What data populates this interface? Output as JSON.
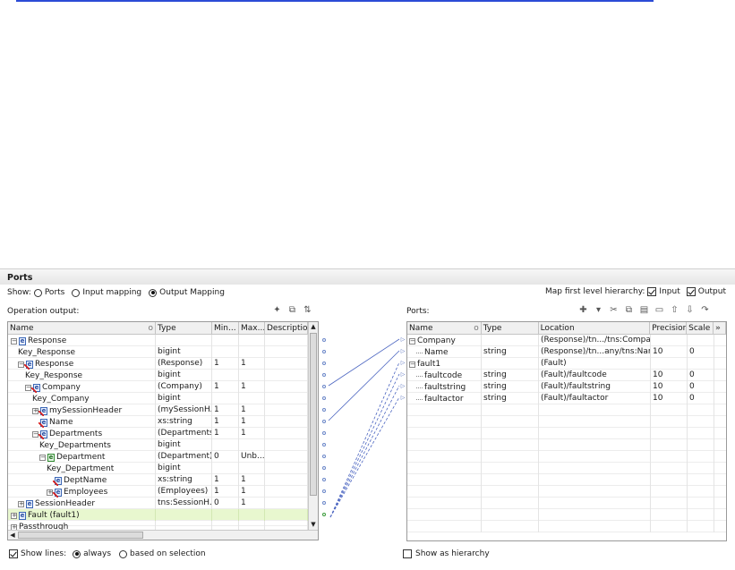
{
  "panel": {
    "title": "Ports"
  },
  "show": {
    "label": "Show:",
    "options": [
      {
        "label": "Ports",
        "selected": false
      },
      {
        "label": "Input mapping",
        "selected": false
      },
      {
        "label": "Output Mapping",
        "selected": true
      }
    ]
  },
  "hierarchy": {
    "label": "Map first level hierarchy:",
    "input_label": "Input",
    "input_checked": true,
    "output_label": "Output",
    "output_checked": true
  },
  "left": {
    "label": "Operation output:",
    "toolbar_icons": [
      "add-port-icon",
      "copy-icon",
      "sort-icon"
    ],
    "columns": [
      "Name",
      "Type",
      "Min...",
      "Max...",
      "Description"
    ],
    "rows": [
      {
        "name": "Response",
        "type": "",
        "min": "",
        "max": "",
        "level": 0,
        "exp": "−",
        "icon": "e"
      },
      {
        "name": "Key_Response",
        "type": "bigint",
        "min": "",
        "max": "",
        "level": 1,
        "exp": "",
        "icon": ""
      },
      {
        "name": "Response",
        "type": "(Response)",
        "min": "1",
        "max": "1",
        "level": 1,
        "exp": "−",
        "icon": "e-red"
      },
      {
        "name": "Key_Response",
        "type": "bigint",
        "min": "",
        "max": "",
        "level": 2,
        "exp": "",
        "icon": ""
      },
      {
        "name": "Company",
        "type": "(Company)",
        "min": "1",
        "max": "1",
        "level": 2,
        "exp": "−",
        "icon": "e-red"
      },
      {
        "name": "Key_Company",
        "type": "bigint",
        "min": "",
        "max": "",
        "level": 3,
        "exp": "",
        "icon": ""
      },
      {
        "name": "mySessionHeader",
        "type": "(mySessionH...",
        "min": "1",
        "max": "1",
        "level": 3,
        "exp": "+",
        "icon": "e-red"
      },
      {
        "name": "Name",
        "type": "xs:string",
        "min": "1",
        "max": "1",
        "level": 3,
        "exp": "",
        "icon": "e-red"
      },
      {
        "name": "Departments",
        "type": "(Departments)",
        "min": "1",
        "max": "1",
        "level": 3,
        "exp": "−",
        "icon": "e-red"
      },
      {
        "name": "Key_Departments",
        "type": "bigint",
        "min": "",
        "max": "",
        "level": 4,
        "exp": "",
        "icon": ""
      },
      {
        "name": "Department",
        "type": "(Department)",
        "min": "0",
        "max": "Unb...",
        "level": 4,
        "exp": "−",
        "icon": "e-grn"
      },
      {
        "name": "Key_Department",
        "type": "bigint",
        "min": "",
        "max": "",
        "level": 5,
        "exp": "",
        "icon": ""
      },
      {
        "name": "DeptName",
        "type": "xs:string",
        "min": "1",
        "max": "1",
        "level": 5,
        "exp": "",
        "icon": "e-red"
      },
      {
        "name": "Employees",
        "type": "(Employees)",
        "min": "1",
        "max": "1",
        "level": 5,
        "exp": "+",
        "icon": "e-red"
      },
      {
        "name": "SessionHeader",
        "type": "tns:SessionH...",
        "min": "0",
        "max": "1",
        "level": 1,
        "exp": "+",
        "icon": "e"
      },
      {
        "name": "Fault (fault1)",
        "type": "",
        "min": "",
        "max": "",
        "level": 0,
        "exp": "+",
        "icon": "e",
        "highlight": true
      },
      {
        "name": "Passthrough",
        "type": "",
        "min": "",
        "max": "",
        "level": 0,
        "exp": "+",
        "icon": "",
        "cut": true
      }
    ]
  },
  "right": {
    "label": "Ports:",
    "toolbar_icons": [
      "new-icon",
      "dropdown-icon",
      "cut-icon",
      "copy-icon",
      "paste-icon",
      "delete-icon",
      "move-up-icon",
      "move-down-icon",
      "more-icon"
    ],
    "columns": [
      "Name",
      "Type",
      "Location",
      "Precision",
      "Scale"
    ],
    "rows": [
      {
        "name": "Company",
        "type": "",
        "location": "(Response)/tn.../tns:Company",
        "precision": "",
        "scale": "",
        "level": 0,
        "exp": "−"
      },
      {
        "name": "Name",
        "type": "string",
        "location": "(Response)/tn...any/tns:Name",
        "precision": "10",
        "scale": "0",
        "level": 1,
        "exp": ""
      },
      {
        "name": "fault1",
        "type": "",
        "location": "(Fault)",
        "precision": "",
        "scale": "",
        "level": 0,
        "exp": "−"
      },
      {
        "name": "faultcode",
        "type": "string",
        "location": "(Fault)/faultcode",
        "precision": "10",
        "scale": "0",
        "level": 1,
        "exp": ""
      },
      {
        "name": "faultstring",
        "type": "string",
        "location": "(Fault)/faultstring",
        "precision": "10",
        "scale": "0",
        "level": 1,
        "exp": ""
      },
      {
        "name": "faultactor",
        "type": "string",
        "location": "(Fault)/faultactor",
        "precision": "10",
        "scale": "0",
        "level": 1,
        "exp": ""
      }
    ]
  },
  "show_lines": {
    "label": "Show lines:",
    "always_label": "always",
    "always_selected": true,
    "selection_label": "based on selection",
    "selection_selected": false
  },
  "show_hierarchy": {
    "label": "Show as hierarchy",
    "checked": false
  }
}
